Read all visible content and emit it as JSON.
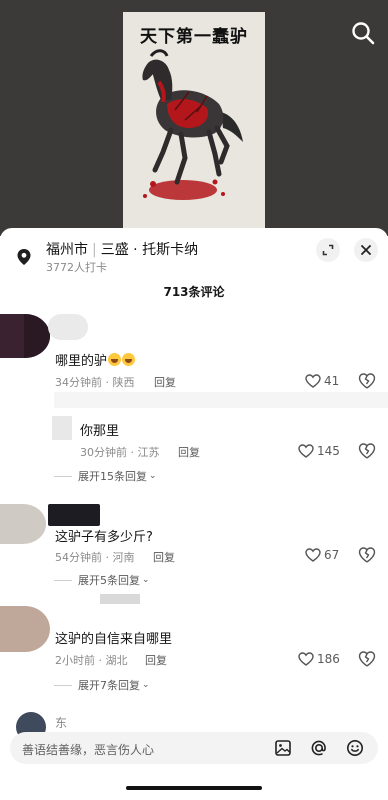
{
  "video": {
    "painting_title": "天下第一蠢驴",
    "search_icon": "search-icon"
  },
  "location": {
    "icon": "location-pin-icon",
    "city": "福州市",
    "place": "三盛 · 托斯卡纳",
    "checkins": "3772人打卡"
  },
  "comments_header": {
    "count": "713条评论"
  },
  "comments": [
    {
      "text": "哪里的驴",
      "emojis": [
        "laugh-crying-emoji",
        "laugh-crying-emoji"
      ],
      "time": "34分钟前 · 陕西",
      "reply": "回复",
      "likes": "41"
    },
    {
      "text": "你那里",
      "time": "30分钟前 · 江苏",
      "reply": "回复",
      "likes": "145",
      "expand": "展开15条回复"
    },
    {
      "text": "这驴子有多少斤?",
      "time": "54分钟前 · 河南",
      "reply": "回复",
      "likes": "67",
      "expand": "展开5条回复"
    },
    {
      "text": "这驴的自信来自哪里",
      "time": "2小时前 · 湖北",
      "reply": "回复",
      "likes": "186",
      "expand": "展开7条回复"
    }
  ],
  "partial_comment": {
    "name": "东"
  },
  "input": {
    "placeholder": "善语结善缘，恶言伤人心",
    "icons": [
      "image-icon",
      "at-icon",
      "emoji-icon"
    ]
  },
  "colors": {
    "video_bg": "#3b3a38",
    "blood_red": "#b3171c",
    "input_bg": "#f3f3f4"
  }
}
